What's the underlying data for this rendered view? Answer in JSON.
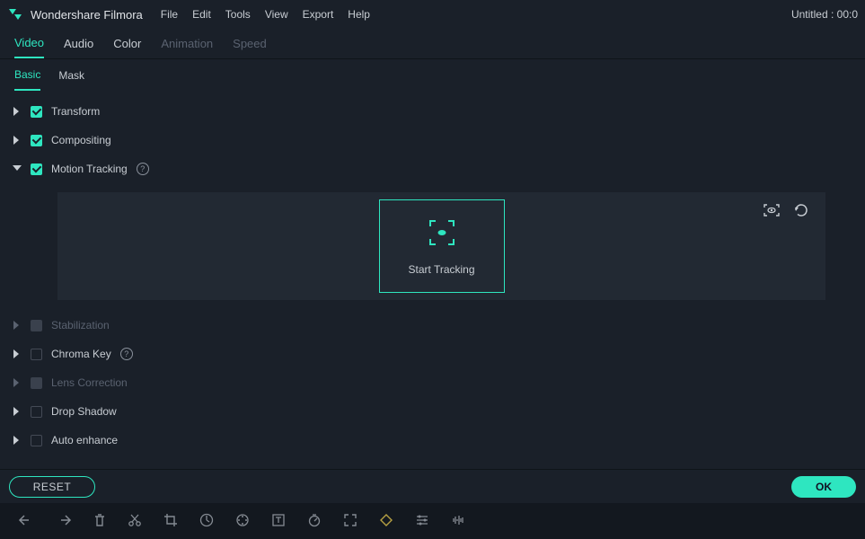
{
  "app": {
    "name": "Wondershare Filmora",
    "title_status": "Untitled : 00:0"
  },
  "menu": {
    "file": "File",
    "edit": "Edit",
    "tools": "Tools",
    "view": "View",
    "export": "Export",
    "help": "Help"
  },
  "maintabs": {
    "video": "Video",
    "audio": "Audio",
    "color": "Color",
    "animation": "Animation",
    "speed": "Speed"
  },
  "subtabs": {
    "basic": "Basic",
    "mask": "Mask"
  },
  "props": {
    "transform": "Transform",
    "compositing": "Compositing",
    "motion_tracking": "Motion Tracking",
    "stabilization": "Stabilization",
    "chroma_key": "Chroma Key",
    "lens_correction": "Lens Correction",
    "drop_shadow": "Drop Shadow",
    "auto_enhance": "Auto enhance"
  },
  "tracking": {
    "start_label": "Start Tracking"
  },
  "buttons": {
    "reset": "RESET",
    "ok": "OK"
  }
}
